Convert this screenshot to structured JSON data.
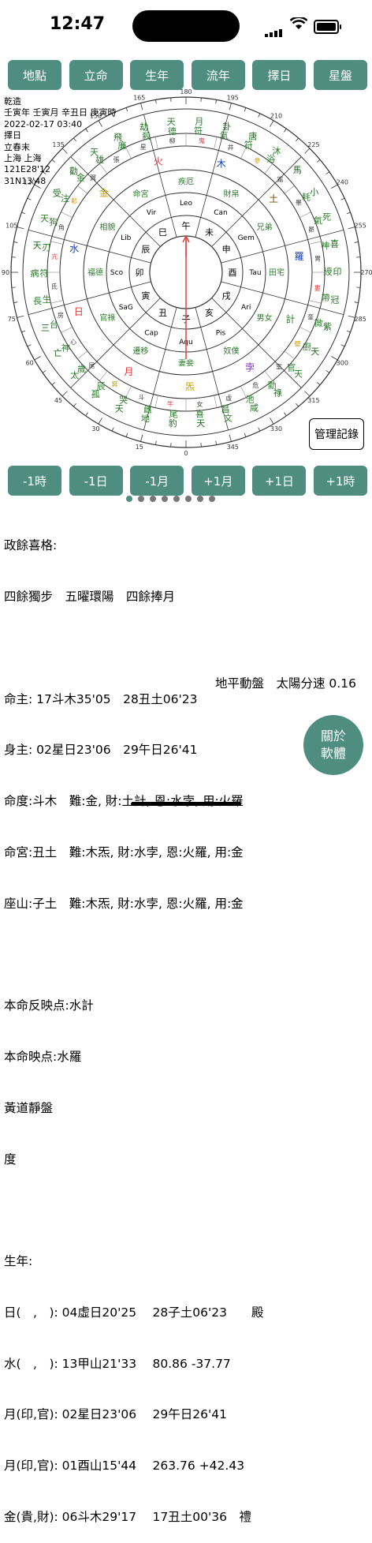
{
  "status": {
    "time": "12:47"
  },
  "top_buttons": [
    "地點",
    "立命",
    "生年",
    "流年",
    "擇日",
    "星盤"
  ],
  "nav_buttons": [
    "-1時",
    "-1日",
    "-1月",
    "+1月",
    "+1日",
    "+1時"
  ],
  "manage_button": "管理記錄",
  "about_button": [
    "關於",
    "軟體"
  ],
  "info_lines": [
    "乾造",
    "壬寅年 壬寅月 辛丑日 庚寅時",
    "2022-02-17 03:40",
    "擇日",
    "立春末",
    "上海 上海",
    "121E28'12",
    "31N13'48"
  ],
  "degree_labels": [
    "180",
    "165",
    "195",
    "150",
    "210",
    "135",
    "225",
    "120",
    "240",
    "105",
    "255",
    "90",
    "270",
    "75",
    "285",
    "60",
    "300",
    "45",
    "315",
    "30",
    "330",
    "15",
    "345",
    "0"
  ],
  "branches": [
    "午",
    "未",
    "申",
    "酉",
    "戌",
    "亥",
    "子",
    "丑",
    "寅",
    "卯",
    "辰",
    "巳"
  ],
  "signs": [
    "Leo",
    "Can",
    "Gem",
    "Tau",
    "Ari",
    "Pis",
    "Aqu",
    "Cap",
    "SaG",
    "Sco",
    "Lib",
    "Vir"
  ],
  "mansions": [
    "柳",
    "鬼",
    "井",
    "參",
    "觜",
    "畢",
    "昴",
    "胃",
    "婁",
    "奎",
    "壁",
    "室",
    "危",
    "虛",
    "女",
    "牛",
    "斗",
    "箕",
    "尾",
    "心",
    "房",
    "氐",
    "亢",
    "角",
    "軫",
    "翼",
    "張",
    "星"
  ],
  "palaces": [
    "疾厄",
    "財帛",
    "兄弟",
    "田宅",
    "男女",
    "奴僕",
    "妻妾",
    "遷移",
    "官祿",
    "福德",
    "相貌",
    "命宮"
  ],
  "outer_stars": [
    "月符",
    "卦氣",
    "唐符",
    "沐浴",
    "馬",
    "小耗",
    "死氣",
    "喜神",
    "印綬",
    "冠帶",
    "紫微",
    "天廚",
    "天官",
    "祿勳",
    "咸池",
    "文昌",
    "天喜",
    "豹尾",
    "地雌",
    "天哭",
    "孤辰",
    "太歲",
    "亡神",
    "三台",
    "長生",
    "病符",
    "天刃",
    "天狗",
    "受注",
    "勸金",
    "天雄",
    "飛廉",
    "劫殺",
    "天德"
  ],
  "planets_inner": [
    "日",
    "水",
    "金",
    "火",
    "木",
    "土",
    "羅",
    "計",
    "孛",
    "炁",
    "月"
  ],
  "text_lines": [
    "政餘喜格:",
    "四餘獨步　五曜環陽　四餘捧月",
    "",
    "命主: 17斗木35'05　28丑土06'23",
    "身主: 02星日23'06　29午日26'41",
    "命度:斗木　難:金, 財:土計, 恩:水孛, 用:火羅",
    "命宮:丑土　難:木炁, 財:水孛, 恩:火羅, 用:金",
    "座山:子土　難:木炁, 財:水孛, 恩:火羅, 用:金",
    "",
    "本命反映点:水計",
    "本命映点:水羅",
    "黃道靜盤",
    "度",
    "",
    "生年:",
    "日(　,　): 04虛日20'25　 28子土06'23　　殿",
    "水(　,　): 13甲山21'33　 80.86 -37.77",
    "月(印,官): 02星日23'06　 29午日26'41",
    "月(印,官): 01酉山15'44　 263.76 +42.43",
    "金(貴,財): 06斗木29'17　 17丑土00'36　禮"
  ],
  "right_text": "地平動盤　太陽分速 0.16"
}
